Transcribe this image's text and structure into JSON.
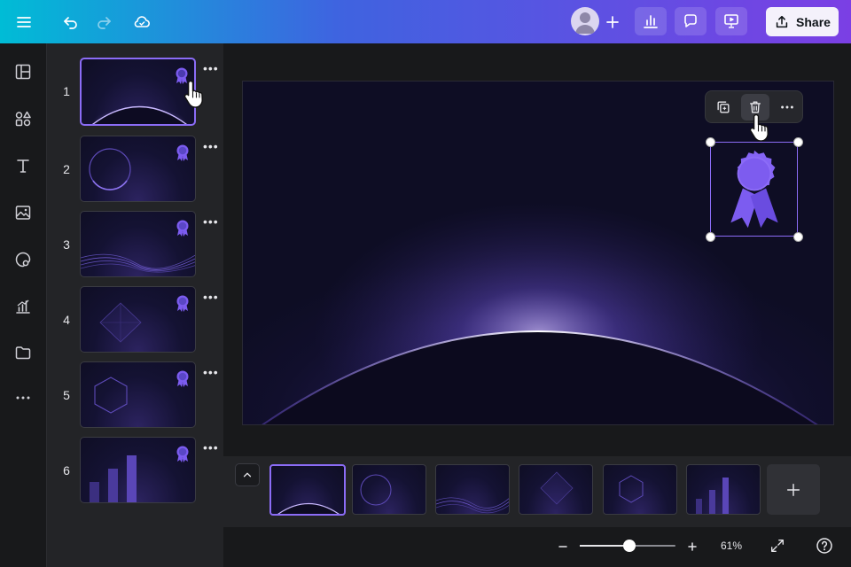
{
  "topbar": {
    "share_label": "Share",
    "icons": [
      "menu-icon",
      "undo-icon",
      "redo-icon",
      "cloud-icon",
      "avatar-icon",
      "plus-icon",
      "analytics-icon",
      "comment-icon",
      "present-icon",
      "share-icon"
    ]
  },
  "rail": {
    "icons": [
      "layout-icon",
      "elements-icon",
      "text-icon",
      "photo-icon",
      "brand-icon",
      "charts-icon",
      "folder-icon",
      "more-icon"
    ]
  },
  "slides": [
    {
      "number": "1",
      "design": "arc"
    },
    {
      "number": "2",
      "design": "circle"
    },
    {
      "number": "3",
      "design": "waves"
    },
    {
      "number": "4",
      "design": "diamond"
    },
    {
      "number": "5",
      "design": "hexagon"
    },
    {
      "number": "6",
      "design": "bars"
    }
  ],
  "slide_more_label": "•••",
  "footer": {
    "zoom_label": "61%",
    "zoom_level": 0.52
  },
  "colors": {
    "accent": "#8b6cf6",
    "badge": "#7c5cf0"
  }
}
